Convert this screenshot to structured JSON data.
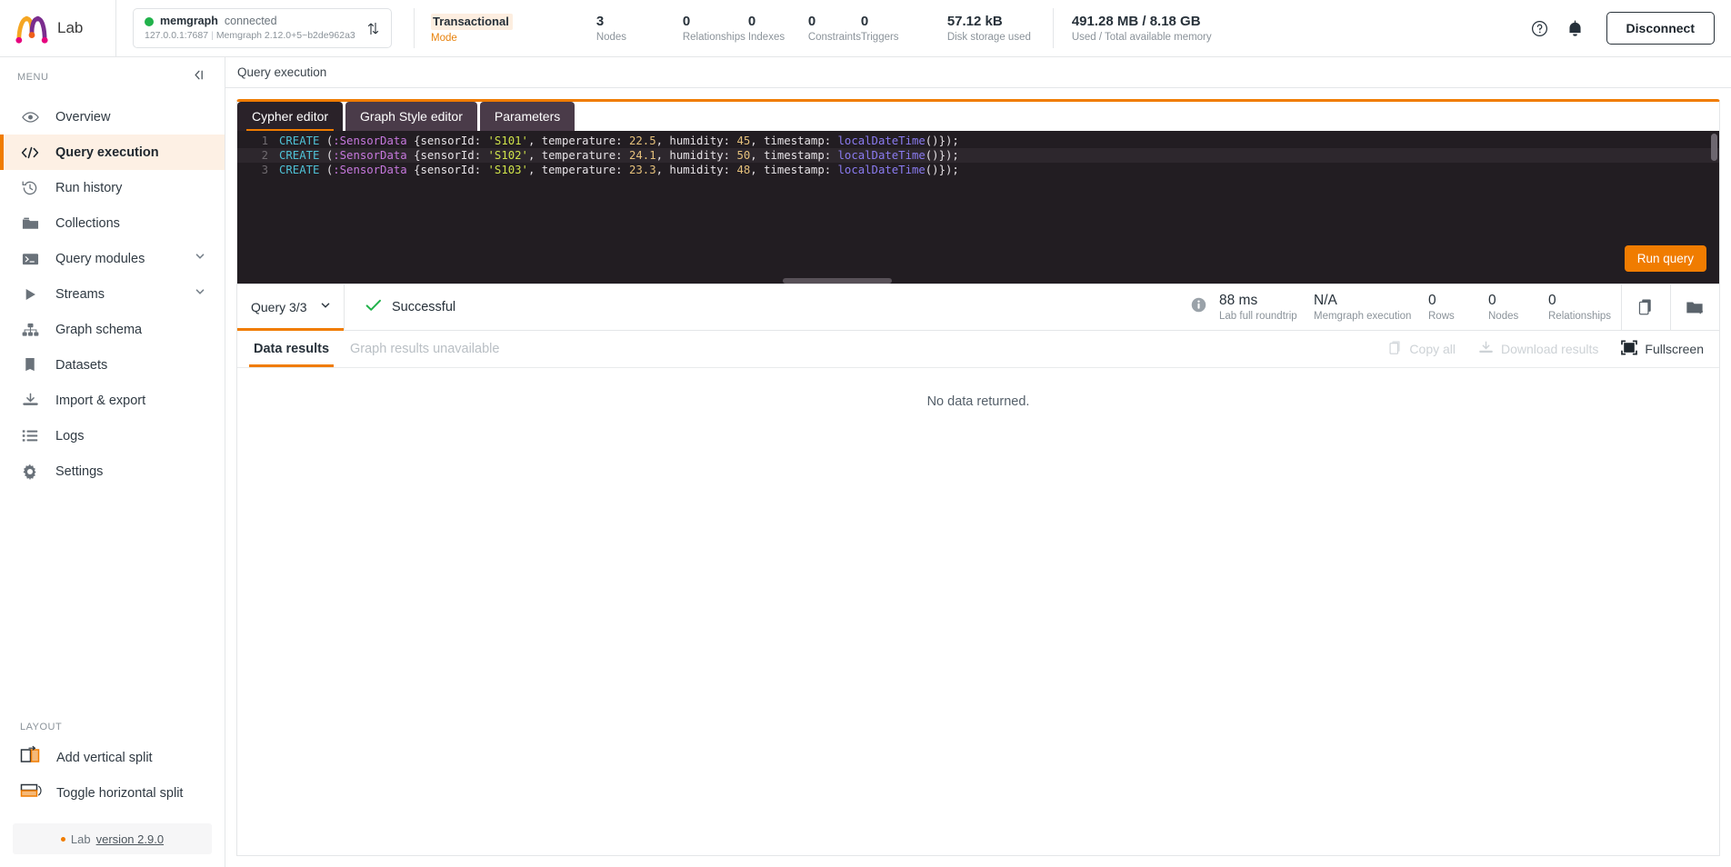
{
  "topbar": {
    "brand": "Lab",
    "connection": {
      "db_name": "memgraph",
      "state": "connected",
      "host": "127.0.0.1:7687",
      "version": "Memgraph 2.12.0+5~b2de962a3"
    },
    "mode": {
      "name": "Transactional",
      "label": "Mode"
    },
    "stats": [
      {
        "value": "3",
        "label": "Nodes"
      },
      {
        "value": "0",
        "label": "Relationships"
      },
      {
        "value": "0",
        "label": "Indexes"
      },
      {
        "value": "0",
        "label": "Constraints"
      },
      {
        "value": "0",
        "label": "Triggers"
      },
      {
        "value": "57.12 kB",
        "label": "Disk storage used"
      }
    ],
    "memory": {
      "value": "491.28 MB / 8.18 GB",
      "label": "Used / Total available memory"
    },
    "disconnect_label": "Disconnect"
  },
  "sidebar": {
    "menu_label": "MENU",
    "items": [
      {
        "label": "Overview",
        "icon": "eye-icon",
        "active": false,
        "expandable": false
      },
      {
        "label": "Query execution",
        "icon": "code-icon",
        "active": true,
        "expandable": false
      },
      {
        "label": "Run history",
        "icon": "history-icon",
        "active": false,
        "expandable": false
      },
      {
        "label": "Collections",
        "icon": "folder-icon",
        "active": false,
        "expandable": false
      },
      {
        "label": "Query modules",
        "icon": "terminal-icon",
        "active": false,
        "expandable": true
      },
      {
        "label": "Streams",
        "icon": "play-icon",
        "active": false,
        "expandable": true
      },
      {
        "label": "Graph schema",
        "icon": "schema-icon",
        "active": false,
        "expandable": false
      },
      {
        "label": "Datasets",
        "icon": "book-icon",
        "active": false,
        "expandable": false
      },
      {
        "label": "Import & export",
        "icon": "download-icon",
        "active": false,
        "expandable": false
      },
      {
        "label": "Logs",
        "icon": "list-icon",
        "active": false,
        "expandable": false
      },
      {
        "label": "Settings",
        "icon": "gear-icon",
        "active": false,
        "expandable": false
      }
    ],
    "layout_label": "LAYOUT",
    "layout_items": [
      {
        "label": "Add vertical split",
        "icon": "vertical-split-icon"
      },
      {
        "label": "Toggle horizontal split",
        "icon": "horizontal-split-icon"
      }
    ],
    "version_prefix": "Lab",
    "version_link": "version 2.9.0"
  },
  "main": {
    "page_title": "Query execution",
    "tabs": [
      {
        "label": "Cypher editor",
        "active": true
      },
      {
        "label": "Graph Style editor",
        "active": false
      },
      {
        "label": "Parameters",
        "active": false
      }
    ],
    "run_button": "Run query",
    "code_lines": [
      {
        "number": "1",
        "tokens": [
          {
            "t": "CREATE",
            "c": "kw"
          },
          {
            "t": " (",
            "c": "punc"
          },
          {
            "t": ":SensorData",
            "c": "lbl"
          },
          {
            "t": " {sensorId: ",
            "c": "prop"
          },
          {
            "t": "'S101'",
            "c": "str"
          },
          {
            "t": ", temperature: ",
            "c": "prop"
          },
          {
            "t": "22.5",
            "c": "num"
          },
          {
            "t": ", humidity: ",
            "c": "prop"
          },
          {
            "t": "45",
            "c": "num"
          },
          {
            "t": ", timestamp: ",
            "c": "prop"
          },
          {
            "t": "localDateTime",
            "c": "fn"
          },
          {
            "t": "()});",
            "c": "punc"
          }
        ]
      },
      {
        "number": "2",
        "tokens": [
          {
            "t": "CREATE",
            "c": "kw"
          },
          {
            "t": " (",
            "c": "punc"
          },
          {
            "t": ":SensorData",
            "c": "lbl"
          },
          {
            "t": " {sensorId: ",
            "c": "prop"
          },
          {
            "t": "'S102'",
            "c": "str"
          },
          {
            "t": ", temperature: ",
            "c": "prop"
          },
          {
            "t": "24.1",
            "c": "num"
          },
          {
            "t": ", humidity: ",
            "c": "prop"
          },
          {
            "t": "50",
            "c": "num"
          },
          {
            "t": ", timestamp: ",
            "c": "prop"
          },
          {
            "t": "localDateTime",
            "c": "fn"
          },
          {
            "t": "()});",
            "c": "punc"
          }
        ]
      },
      {
        "number": "3",
        "tokens": [
          {
            "t": "CREATE",
            "c": "kw"
          },
          {
            "t": " (",
            "c": "punc"
          },
          {
            "t": ":SensorData",
            "c": "lbl"
          },
          {
            "t": " {sensorId: ",
            "c": "prop"
          },
          {
            "t": "'S103'",
            "c": "str"
          },
          {
            "t": ", temperature: ",
            "c": "prop"
          },
          {
            "t": "23.3",
            "c": "num"
          },
          {
            "t": ", humidity: ",
            "c": "prop"
          },
          {
            "t": "48",
            "c": "num"
          },
          {
            "t": ", timestamp: ",
            "c": "prop"
          },
          {
            "t": "localDateTime",
            "c": "fn"
          },
          {
            "t": "()});",
            "c": "punc"
          }
        ]
      }
    ],
    "result_bar": {
      "query_selector": "Query 3/3",
      "status": "Successful",
      "metrics": [
        {
          "value": "88 ms",
          "label": "Lab full roundtrip"
        },
        {
          "value": "N/A",
          "label": "Memgraph execution"
        },
        {
          "value": "0",
          "label": "Rows"
        },
        {
          "value": "0",
          "label": "Nodes"
        },
        {
          "value": "0",
          "label": "Relationships"
        }
      ]
    },
    "results": {
      "tabs": [
        {
          "label": "Data results",
          "active": true,
          "disabled": false
        },
        {
          "label": "Graph results unavailable",
          "active": false,
          "disabled": true
        }
      ],
      "tools": [
        {
          "label": "Copy all",
          "icon": "copy-icon",
          "enabled": false
        },
        {
          "label": "Download results",
          "icon": "download-icon",
          "enabled": false
        },
        {
          "label": "Fullscreen",
          "icon": "fullscreen-icon",
          "enabled": true
        }
      ],
      "empty_message": "No data returned."
    }
  },
  "colors": {
    "accent": "#f07c00",
    "accent_bg": "#fdf0e4",
    "success": "#21b24b",
    "text": "#27313a",
    "muted": "#8b939a",
    "editor_bg": "#221d22"
  }
}
